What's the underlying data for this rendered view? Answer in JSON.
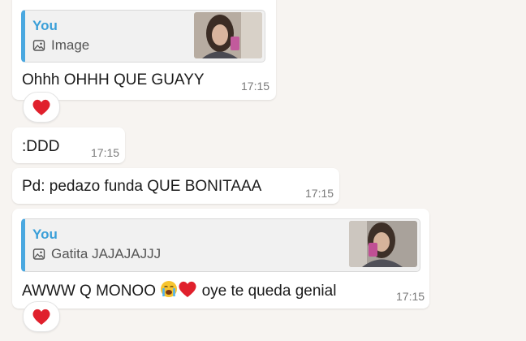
{
  "messages": [
    {
      "quote": {
        "author": "You",
        "label": "Image",
        "icon": "image-icon"
      },
      "text": "Ohhh OHHH QUE GUAYY",
      "time": "17:15",
      "reaction": "heart"
    },
    {
      "text": ":DDD",
      "time": "17:15"
    },
    {
      "text": "Pd: pedazo funda QUE BONITAAA",
      "time": "17:15"
    },
    {
      "quote": {
        "author": "You",
        "label": "Gatita JAJAJAJJJ",
        "icon": "image-icon"
      },
      "text_before": "AWWW Q MONOO",
      "emojis": [
        "crying-face",
        "red-heart"
      ],
      "text_after": "oye te queda genial",
      "time": "17:15",
      "reaction": "heart"
    }
  ],
  "colors": {
    "background": "#f7f4f1",
    "bubble": "#ffffff",
    "quote_accent": "#4aa8e0",
    "quote_author": "#3a9fd8",
    "heart": "#e0202c"
  }
}
